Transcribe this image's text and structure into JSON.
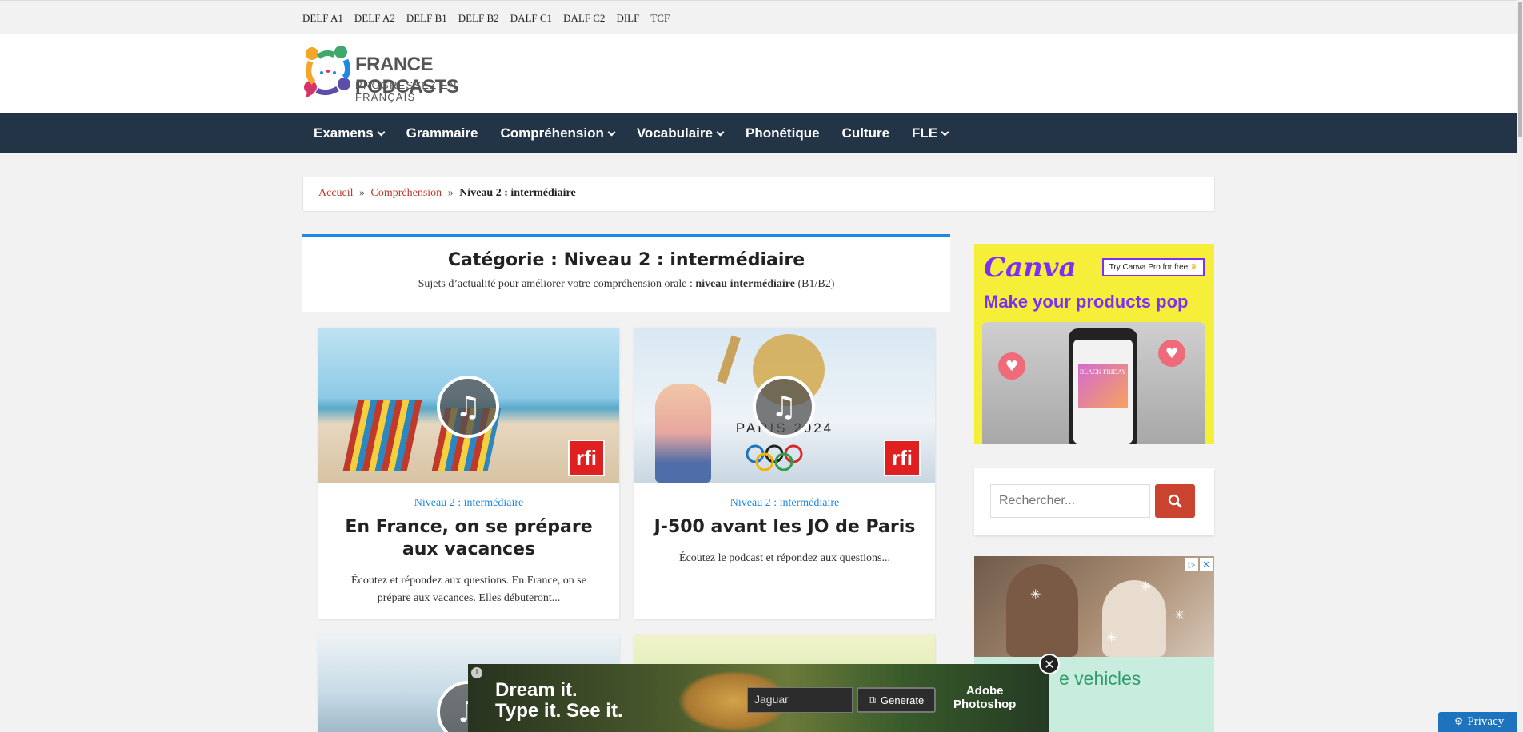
{
  "topbar": {
    "links": [
      "DELF A1",
      "DELF A2",
      "DELF B1",
      "DELF B2",
      "DALF C1",
      "DALF C2",
      "DILF",
      "TCF"
    ]
  },
  "logo": {
    "title": "FRANCE PODCASTS",
    "tagline": "PROGRESSEZ EN FRANÇAIS"
  },
  "nav": {
    "items": [
      {
        "label": "Examens",
        "dropdown": true
      },
      {
        "label": "Grammaire",
        "dropdown": false
      },
      {
        "label": "Compréhension",
        "dropdown": true
      },
      {
        "label": "Vocabulaire",
        "dropdown": true
      },
      {
        "label": "Phonétique",
        "dropdown": false
      },
      {
        "label": "Culture",
        "dropdown": false
      },
      {
        "label": "FLE",
        "dropdown": true
      }
    ]
  },
  "breadcrumb": {
    "home": "Accueil",
    "sep": "»",
    "parent": "Compréhension",
    "current": "Niveau 2 : intermédiaire"
  },
  "category": {
    "title": "Catégorie : Niveau 2 : intermédiaire",
    "desc_before": "Sujets d’actualité pour améliorer votre compréhension orale :",
    "desc_bold": "niveau intermédiaire",
    "desc_after": "(B1/B2)"
  },
  "posts": [
    {
      "category": "Niveau 2 : intermédiaire",
      "title": "En France, on se prépare aux vacances",
      "excerpt": "Écoutez et répondez aux questions. En France, on se prépare aux vacances. Elles débuteront...",
      "badge": "rfi",
      "play_icon": "♫"
    },
    {
      "category": "Niveau 2 : intermédiaire",
      "title": "J-500 avant les JO de Paris",
      "excerpt": "Écoutez le podcast et répondez aux questions...",
      "badge": "rfi",
      "play_icon": "♫",
      "image_text": "PARIS 2024"
    }
  ],
  "ads": {
    "canva": {
      "brand": "Canva",
      "cta": "Try Canva Pro for free",
      "headline": "Make your products pop",
      "screen_text": "BLACK FRIDAY"
    },
    "search": {
      "placeholder": "Rechercher..."
    },
    "vehicles": {
      "text": "e vehicles",
      "adchoice": [
        "▷",
        "✕"
      ]
    },
    "adobe": {
      "headline_1": "Dream it.",
      "headline_2": "Type it. See it.",
      "input_value": "Jaguar",
      "button": "Generate",
      "brand_1": "Adobe",
      "brand_2": "Photoshop",
      "close": "✕"
    }
  },
  "privacy": {
    "label": "Privacy"
  },
  "colors": {
    "nav_bg": "#243447",
    "accent_blue": "#1e88e5",
    "link_red": "#c0392b",
    "search_btn": "#c9432e",
    "canva_purple": "#7b2ff7",
    "canva_yellow": "#f6ef3a"
  }
}
